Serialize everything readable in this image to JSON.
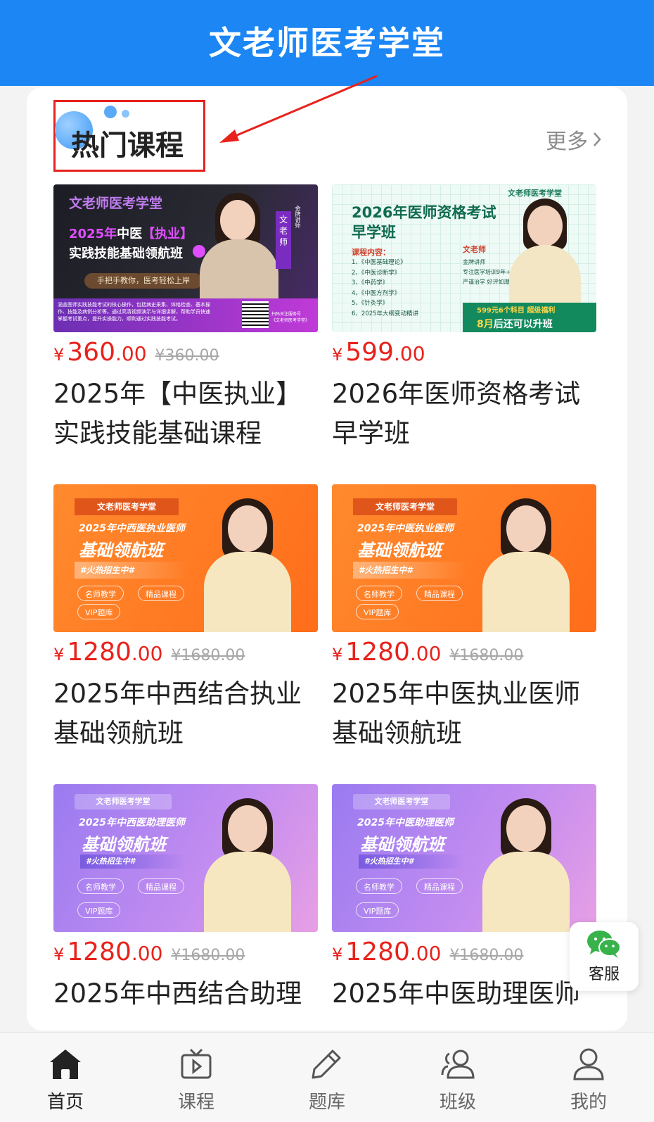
{
  "header": {
    "title": "文老师医考学堂"
  },
  "section": {
    "title": "热门课程",
    "more_label": "更多"
  },
  "courses": [
    {
      "thumb": {
        "brand": "文老师医考学堂",
        "line1_year": "2025年",
        "line1_rest": "中医",
        "line1_highlight": "【执业】",
        "line2": "实践技能基础领航班",
        "tagline": "手把手教你，医考轻松上岸",
        "teacher_tag": "文老师",
        "teacher_title": "金牌讲师",
        "desc1": "涵盖医师实践技能考试的核心操作，包括病史采集、体格检查、基本操",
        "desc2": "作、技能及病例分析等。通过高清视频演示与详细讲解，帮助学员快速",
        "desc3": "掌握考试重点，提升实操能力，顺利通过实践技能考试。",
        "qr_note1": "扫码关注服务号",
        "qr_note2": "《文老师医考学堂》"
      },
      "price_currency": "¥",
      "price_int": "360",
      "price_dec": ".00",
      "price_orig": "¥360.00",
      "name": "2025年【中医执业】实践技能基础课程"
    },
    {
      "thumb": {
        "brand": "文老师医考学堂",
        "title1": "2026年医师资格考试",
        "title2": "早学班",
        "content_label": "课程内容：",
        "items": [
          "1、《中医基础理论》",
          "2、《中医诊断学》",
          "3、《中药学》",
          "4、《中医方剂学》",
          "5、《针灸学》",
          "6、2025年大纲变动精讲"
        ],
        "teacher": "文老师",
        "teacher_lines": [
          "金牌讲师",
          "专注医学培训9年+",
          "严谨治学 好评如潮"
        ],
        "promo1": "599元6个科目 超级福利",
        "promo2_month": "8月",
        "promo2_rest": "后还可以升班"
      },
      "price_currency": "¥",
      "price_int": "599",
      "price_dec": ".00",
      "price_orig": "",
      "name": "2026年医师资格考试早学班"
    },
    {
      "thumb": {
        "brand": "文老师医考学堂",
        "subtitle": "2025年中西医执业医师",
        "title": "基础领航班",
        "hot": "#火热招生中#",
        "chips": [
          "名师教学",
          "精品课程",
          "VIP题库"
        ]
      },
      "price_currency": "¥",
      "price_int": "1280",
      "price_dec": ".00",
      "price_orig": "¥1680.00",
      "name": "2025年中西结合执业基础领航班"
    },
    {
      "thumb": {
        "brand": "文老师医考学堂",
        "subtitle": "2025年中医执业医师",
        "title": "基础领航班",
        "hot": "#火热招生中#",
        "chips": [
          "名师教学",
          "精品课程",
          "VIP题库"
        ]
      },
      "price_currency": "¥",
      "price_int": "1280",
      "price_dec": ".00",
      "price_orig": "¥1680.00",
      "name": "2025年中医执业医师基础领航班"
    },
    {
      "thumb": {
        "brand": "文老师医考学堂",
        "subtitle": "2025年中西医助理医师",
        "title": "基础领航班",
        "hot": "#火热招生中#",
        "chips": [
          "名师教学",
          "精品课程",
          "VIP题库"
        ]
      },
      "price_currency": "¥",
      "price_int": "1280",
      "price_dec": ".00",
      "price_orig": "¥1680.00",
      "name": "2025年中西结合助理"
    },
    {
      "thumb": {
        "brand": "文老师医考学堂",
        "subtitle": "2025年中医助理医师",
        "title": "基础领航班",
        "hot": "#火热招生中#",
        "chips": [
          "名师教学",
          "精品课程",
          "VIP题库"
        ]
      },
      "price_currency": "¥",
      "price_int": "1280",
      "price_dec": ".00",
      "price_orig": "¥1680.00",
      "name": "2025年中医助理医师"
    }
  ],
  "float_service": {
    "label": "客服",
    "icon": "wechat-icon"
  },
  "tabbar": [
    {
      "label": "首页",
      "icon": "home-icon",
      "active": true
    },
    {
      "label": "课程",
      "icon": "video-icon",
      "active": false
    },
    {
      "label": "题库",
      "icon": "pencil-icon",
      "active": false
    },
    {
      "label": "班级",
      "icon": "users-icon",
      "active": false
    },
    {
      "label": "我的",
      "icon": "user-icon",
      "active": false
    }
  ],
  "colors": {
    "header_bg": "#1b86f4",
    "price": "#e8221c",
    "annotation": "#e8221c"
  }
}
